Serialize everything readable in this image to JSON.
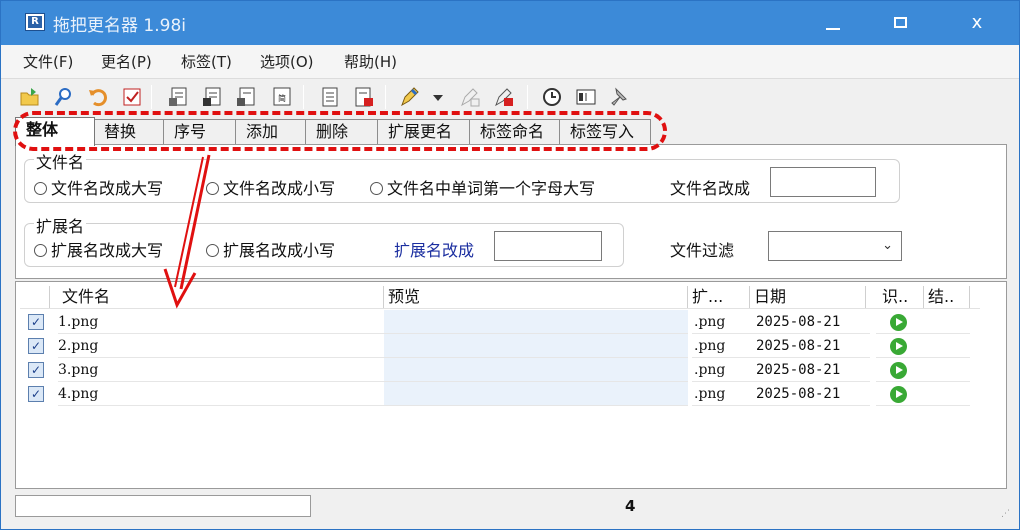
{
  "window": {
    "title": "拖把更名器 1.98i",
    "controls": {
      "minimize": "minimize",
      "maximize": "maximize",
      "close": "x"
    }
  },
  "menu": {
    "items": [
      "文件(F)",
      "更名(P)",
      "标签(T)",
      "选项(O)",
      "帮助(H)"
    ]
  },
  "tabs": {
    "items": [
      "整体",
      "替换",
      "序号",
      "添加",
      "删除",
      "扩展更名",
      "标签命名",
      "标签写入"
    ],
    "active_index": 0
  },
  "filename_group": {
    "label": "文件名",
    "options": [
      "文件名改成大写",
      "文件名改成小写",
      "文件名中单词第一个字母大写"
    ],
    "rename_label": "文件名改成",
    "rename_value": ""
  },
  "extension_group": {
    "label": "扩展名",
    "options": [
      "扩展名改成大写",
      "扩展名改成小写"
    ],
    "rename_label": "扩展名改成",
    "rename_value": ""
  },
  "filter": {
    "label": "文件过滤",
    "value": ""
  },
  "table": {
    "columns": [
      "文件名",
      "预览",
      "扩...",
      "日期",
      "识..",
      "结.."
    ],
    "rows": [
      {
        "name": "1.png",
        "preview": "",
        "ext": ".png",
        "date": "2025-08-21",
        "checked": true,
        "status": "ok"
      },
      {
        "name": "2.png",
        "preview": "",
        "ext": ".png",
        "date": "2025-08-21",
        "checked": true,
        "status": "ok"
      },
      {
        "name": "3.png",
        "preview": "",
        "ext": ".png",
        "date": "2025-08-21",
        "checked": true,
        "status": "ok"
      },
      {
        "name": "4.png",
        "preview": "",
        "ext": ".png",
        "date": "2025-08-21",
        "checked": true,
        "status": "ok"
      }
    ]
  },
  "status": {
    "file_count": "4"
  },
  "icons": [
    "open-folder-icon",
    "search-icon",
    "undo-icon",
    "checkbox-icon",
    "copy-icon",
    "paste-icon",
    "edit-icon",
    "compare-icon",
    "document-icon",
    "document-delete-icon",
    "pen-icon",
    "pen-dropdown-icon",
    "pen-disabled-icon",
    "pen-delete-icon",
    "clock-icon",
    "panel-icon",
    "pin-icon"
  ],
  "colors": {
    "titlebar": "#3c8ad8",
    "annotation": "#e01010",
    "status_ok": "#39a935",
    "preview_bg": "#eaf2fb"
  }
}
